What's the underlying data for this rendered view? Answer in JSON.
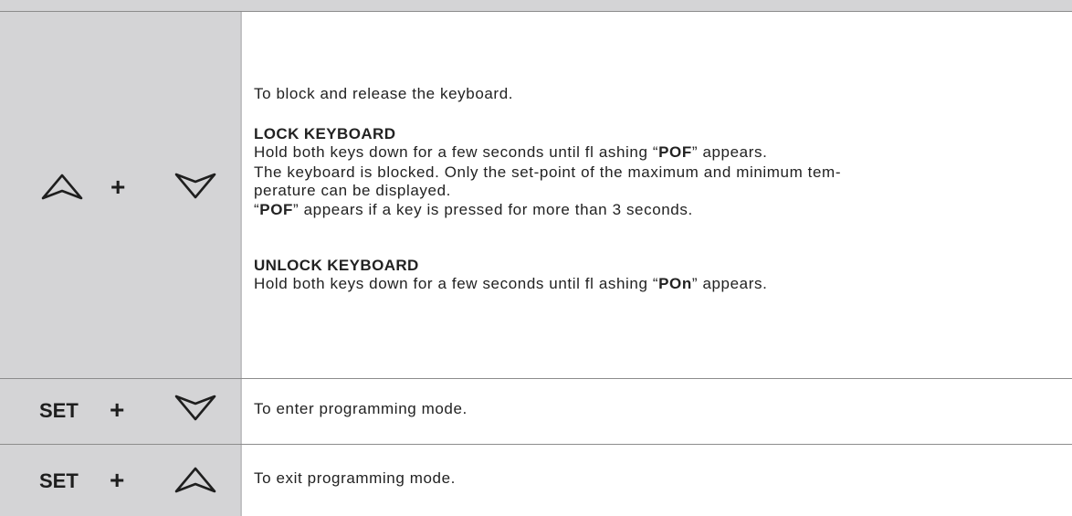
{
  "rows": [
    {
      "keys": {
        "plus": "+"
      },
      "intro": "To block and release the keyboard.",
      "lock": {
        "heading": "LOCK KEYBOARD",
        "line1_pre": "Hold both keys down for a few seconds until fl ashing “",
        "line1_code": "POF",
        "line1_post": "” appears.",
        "line2": "The keyboard is blocked. Only the set-point of the maximum and minimum tem-",
        "line3": "perature can be displayed.",
        "line4_pre": "“",
        "line4_code": "POF",
        "line4_post": "” appears if a key is pressed for more than 3 seconds."
      },
      "unlock": {
        "heading": "UNLOCK KEYBOARD",
        "line1_pre": "Hold both keys down for a few seconds until fl ashing “",
        "line1_code": "POn",
        "line1_post": "” appears."
      }
    },
    {
      "keys": {
        "set": "SET",
        "plus": "+"
      },
      "text": "To enter programming mode."
    },
    {
      "keys": {
        "set": "SET",
        "plus": "+"
      },
      "text": "To exit programming mode."
    }
  ],
  "icons": {
    "up": "up-arrow-icon",
    "down": "down-arrow-icon"
  },
  "colors": {
    "key_cell_bg": "#d4d4d6",
    "rule": "#8c8c8c",
    "text": "#222222"
  }
}
